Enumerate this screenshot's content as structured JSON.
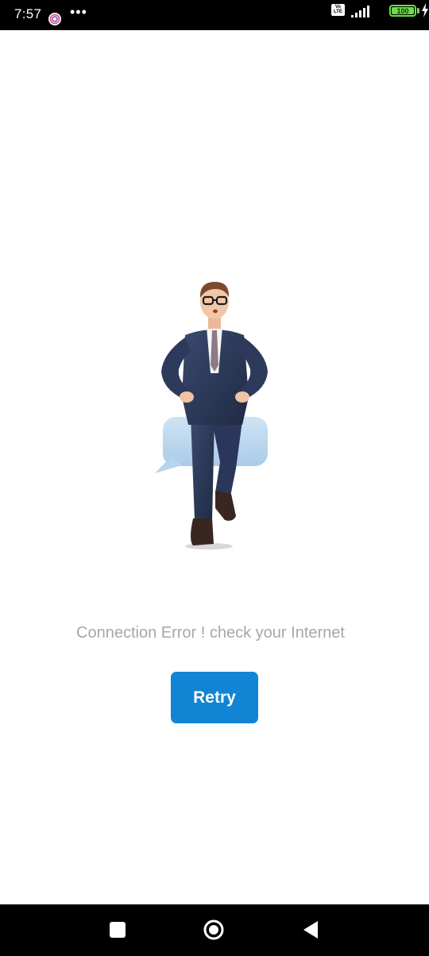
{
  "status_bar": {
    "time": "7:57",
    "app_icon": "app-notification-icon",
    "more": "•••",
    "volte_line1": "Vo",
    "volte_line2": "LTE",
    "battery_level": "100",
    "battery_color": "#6dde47"
  },
  "illustration": {
    "icon": "businessman-on-chat-bubble-illustration"
  },
  "error": {
    "message": "Connection Error ! check your Internet"
  },
  "retry_button": {
    "label": "Retry",
    "color": "#1185d4"
  },
  "nav_bar": {
    "recents_icon": "square-icon",
    "home_icon": "circle-icon",
    "back_icon": "triangle-back-icon"
  }
}
